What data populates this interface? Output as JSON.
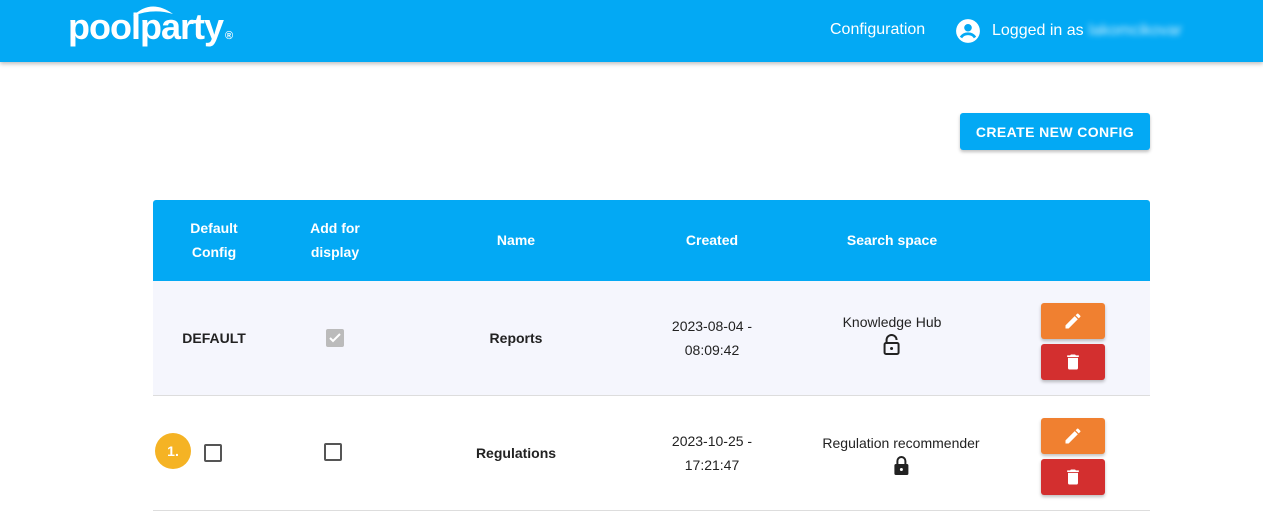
{
  "header": {
    "logo": "poolparty",
    "config_link": "Configuration",
    "logged_in_label": "Logged in as",
    "username": "lakomcikovar"
  },
  "toolbar": {
    "create_label": "CREATE NEW CONFIG"
  },
  "table": {
    "columns": [
      {
        "l1": "Default",
        "l2": "Config"
      },
      {
        "l1": "Add for",
        "l2": "display"
      },
      {
        "l1": "Name"
      },
      {
        "l1": "Created"
      },
      {
        "l1": "Search space"
      }
    ],
    "rows": [
      {
        "default": "DEFAULT",
        "add_checked": true,
        "name": "Reports",
        "created_date": "2023-08-04 -",
        "created_time": "08:09:42",
        "space": "Knowledge Hub",
        "locked": false
      },
      {
        "default_checked": false,
        "add_checked": false,
        "name": "Regulations",
        "created_date": "2023-10-25 -",
        "created_time": "17:21:47",
        "space": "Regulation recommender",
        "locked": true,
        "badge": "1."
      }
    ]
  },
  "colors": {
    "primary": "#03a9f4",
    "edit": "#f08030",
    "delete": "#d32f2f",
    "badge": "#f5b324"
  }
}
